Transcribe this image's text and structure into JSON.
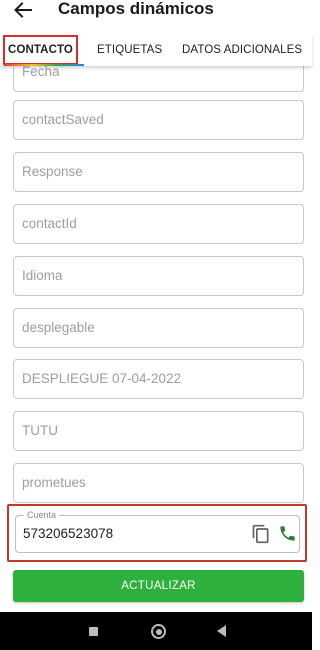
{
  "header": {
    "title": "Campos dinámicos",
    "back_icon": "arrow-left-icon"
  },
  "tabs": [
    {
      "label": "CONTACTO",
      "selected": true
    },
    {
      "label": "ETIQUETAS",
      "selected": false
    },
    {
      "label": "DATOS ADICIONALES",
      "selected": false
    }
  ],
  "fields": [
    {
      "placeholder": "Fecha"
    },
    {
      "placeholder": "contactSaved"
    },
    {
      "placeholder": "Response"
    },
    {
      "placeholder": "contactId"
    },
    {
      "placeholder": "Idioma"
    },
    {
      "placeholder": "desplegable"
    },
    {
      "placeholder": "DESPLIEGUE 07-04-2022"
    },
    {
      "placeholder": "TUTU"
    },
    {
      "placeholder": "prometues"
    }
  ],
  "cuenta": {
    "label": "Cuenta",
    "value": "573206523078",
    "copy_icon": "copy-icon",
    "phone_icon": "phone-icon"
  },
  "actions": {
    "update_label": "ACTUALIZAR"
  },
  "colors": {
    "primary_green": "#2eb03c",
    "highlight_red": "#c0392b"
  },
  "navbar": {
    "icons": [
      "recents-icon",
      "home-icon",
      "back-icon"
    ]
  }
}
